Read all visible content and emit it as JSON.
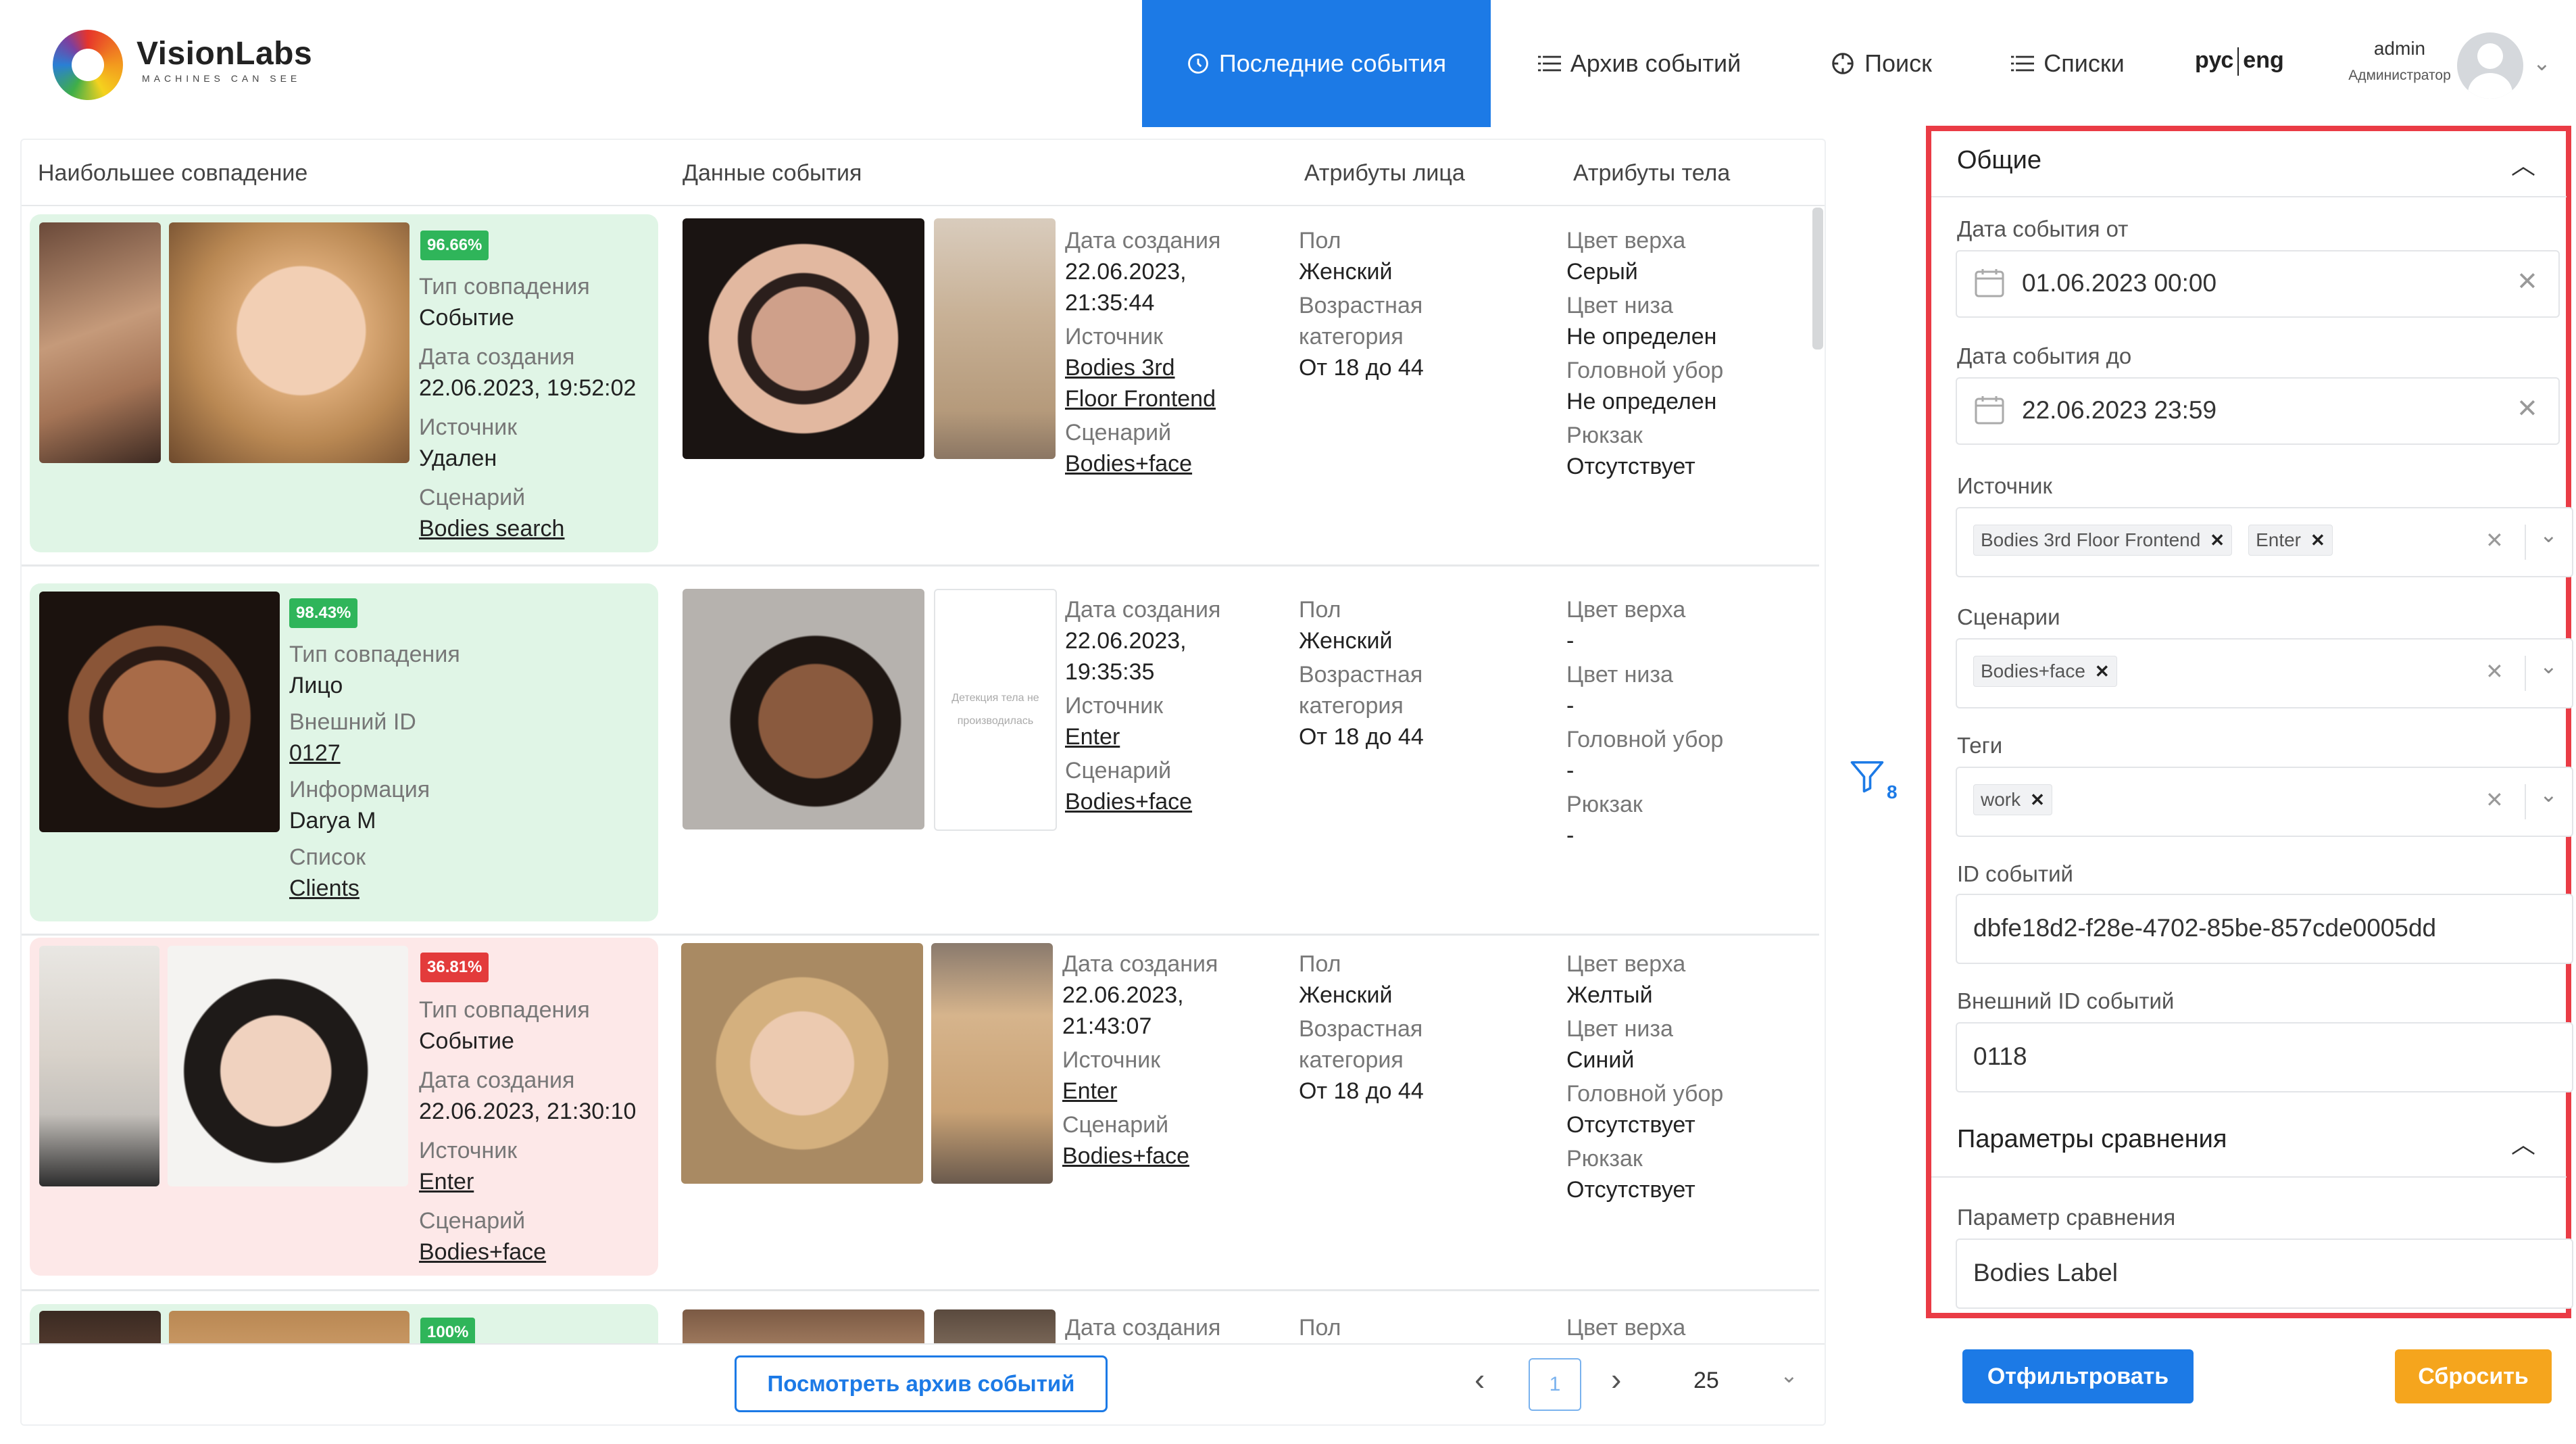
{
  "app": {
    "logo_name": "VisionLabs",
    "logo_tagline": "MACHINES CAN SEE"
  },
  "nav": {
    "items": [
      {
        "label": "Последние события",
        "icon": "clock-icon",
        "active": true
      },
      {
        "label": "Архив событий",
        "icon": "list-icon",
        "active": false
      },
      {
        "label": "Поиск",
        "icon": "search-icon",
        "active": false
      },
      {
        "label": "Списки",
        "icon": "list-icon",
        "active": false
      }
    ],
    "lang_ru": "рус",
    "lang_en": "eng",
    "user_name": "admin",
    "user_role": "Администратор"
  },
  "events": {
    "columns": [
      "Наибольшее совпадение",
      "Данные события",
      "Атрибуты лица",
      "Атрибуты тела"
    ],
    "rows": [
      {
        "match": {
          "percent": "96.66%",
          "status": "green",
          "fields": [
            {
              "label": "Тип совпадения",
              "value": "Событие",
              "link": false
            },
            {
              "label": "Дата создания",
              "value": "22.06.2023, 19:52:02",
              "link": false
            },
            {
              "label": "Источник",
              "value": "Удален",
              "link": false
            },
            {
              "label": "Сценарий",
              "value": "Bodies search",
              "link": true
            }
          ]
        },
        "event": {
          "label_created": "Дата создания",
          "created_1": "22.06.2023,",
          "created_2": "21:35:44",
          "label_source": "Источник",
          "source_1": "Bodies 3rd",
          "source_2": "Floor Frontend",
          "label_scenario": "Сценарий",
          "scenario": "Bodies+face"
        },
        "face": {
          "label_gender": "Пол",
          "gender": "Женский",
          "label_age_1": "Возрастная",
          "label_age_2": "категория",
          "age": "От 18 до 44"
        },
        "body": {
          "label_upper": "Цвет верха",
          "upper": "Серый",
          "label_lower": "Цвет низа",
          "lower": "Не определен",
          "label_head": "Головной убор",
          "head": "Не определен",
          "label_bag": "Рюкзак",
          "bag": "Отсутствует"
        }
      },
      {
        "match": {
          "percent": "98.43%",
          "status": "green",
          "fields": [
            {
              "label": "Тип совпадения",
              "value": "Лицо",
              "link": false
            },
            {
              "label": "Внешний ID",
              "value": "0127",
              "link": true
            },
            {
              "label": "Информация",
              "value": "Darya M",
              "link": false
            },
            {
              "label": "Список",
              "value": "Clients",
              "link": true
            }
          ]
        },
        "event": {
          "label_created": "Дата создания",
          "created_1": "22.06.2023,",
          "created_2": "19:35:35",
          "label_source": "Источник",
          "source_1": "Enter",
          "source_2": "",
          "label_scenario": "Сценарий",
          "scenario": "Bodies+face",
          "no_body_text": "Детекция тела не производилась"
        },
        "face": {
          "label_gender": "Пол",
          "gender": "Женский",
          "label_age_1": "Возрастная",
          "label_age_2": "категория",
          "age": "От 18 до 44"
        },
        "body": {
          "label_upper": "Цвет верха",
          "upper": "-",
          "label_lower": "Цвет низа",
          "lower": "-",
          "label_head": "Головной убор",
          "head": "-",
          "label_bag": "Рюкзак",
          "bag": "-"
        }
      },
      {
        "match": {
          "percent": "36.81%",
          "status": "red",
          "fields": [
            {
              "label": "Тип совпадения",
              "value": "Событие",
              "link": false
            },
            {
              "label": "Дата создания",
              "value": "22.06.2023, 21:30:10",
              "link": false
            },
            {
              "label": "Источник",
              "value": "Enter",
              "link": true
            },
            {
              "label": "Сценарий",
              "value": "Bodies+face",
              "link": true
            }
          ]
        },
        "event": {
          "label_created": "Дата создания",
          "created_1": "22.06.2023,",
          "created_2": "21:43:07",
          "label_source": "Источник",
          "source_1": "Enter",
          "source_2": "",
          "label_scenario": "Сценарий",
          "scenario": "Bodies+face"
        },
        "face": {
          "label_gender": "Пол",
          "gender": "Женский",
          "label_age_1": "Возрастная",
          "label_age_2": "категория",
          "age": "От 18 до 44"
        },
        "body": {
          "label_upper": "Цвет верха",
          "upper": "Желтый",
          "label_lower": "Цвет низа",
          "lower": "Синий",
          "label_head": "Головной убор",
          "head": "Отсутствует",
          "label_bag": "Рюкзак",
          "bag": "Отсутствует"
        }
      },
      {
        "match": {
          "percent": "100%",
          "status": "green"
        },
        "event": {
          "label_created": "Дата создания"
        },
        "face": {
          "label_gender": "Пол"
        },
        "body": {
          "label_upper": "Цвет верха"
        }
      }
    ],
    "archive_button": "Посмотреть архив событий",
    "pagination": {
      "current_page": "1",
      "page_size": "25"
    },
    "filter_count": "8"
  },
  "filters": {
    "section_general": "Общие",
    "date_from_label": "Дата события от",
    "date_from_value": "01.06.2023 00:00",
    "date_to_label": "Дата события до",
    "date_to_value": "22.06.2023 23:59",
    "source_label": "Источник",
    "source_tags": [
      "Bodies 3rd Floor Frontend",
      "Enter"
    ],
    "scenarios_label": "Сценарии",
    "scenario_tags": [
      "Bodies+face"
    ],
    "tags_label": "Теги",
    "tag_values": [
      "work"
    ],
    "event_id_label": "ID событий",
    "event_id_value": "dbfe18d2-f28e-4702-85be-857cde0005dd",
    "external_id_label": "Внешний ID событий",
    "external_id_value": "0118",
    "section_compare": "Параметры сравнения",
    "compare_param_label": "Параметр сравнения",
    "compare_param_value": "Bodies Label",
    "filter_button": "Отфильтровать",
    "reset_button": "Сбросить"
  },
  "colors": {
    "accent": "#1c7ae6",
    "match_green": "#2fb55a",
    "match_red": "#e33b3b",
    "card_green_bg": "#e0f5e6",
    "card_red_bg": "#fde8e8",
    "reset": "#f5a51d",
    "highlight_border": "#ea3b45"
  }
}
